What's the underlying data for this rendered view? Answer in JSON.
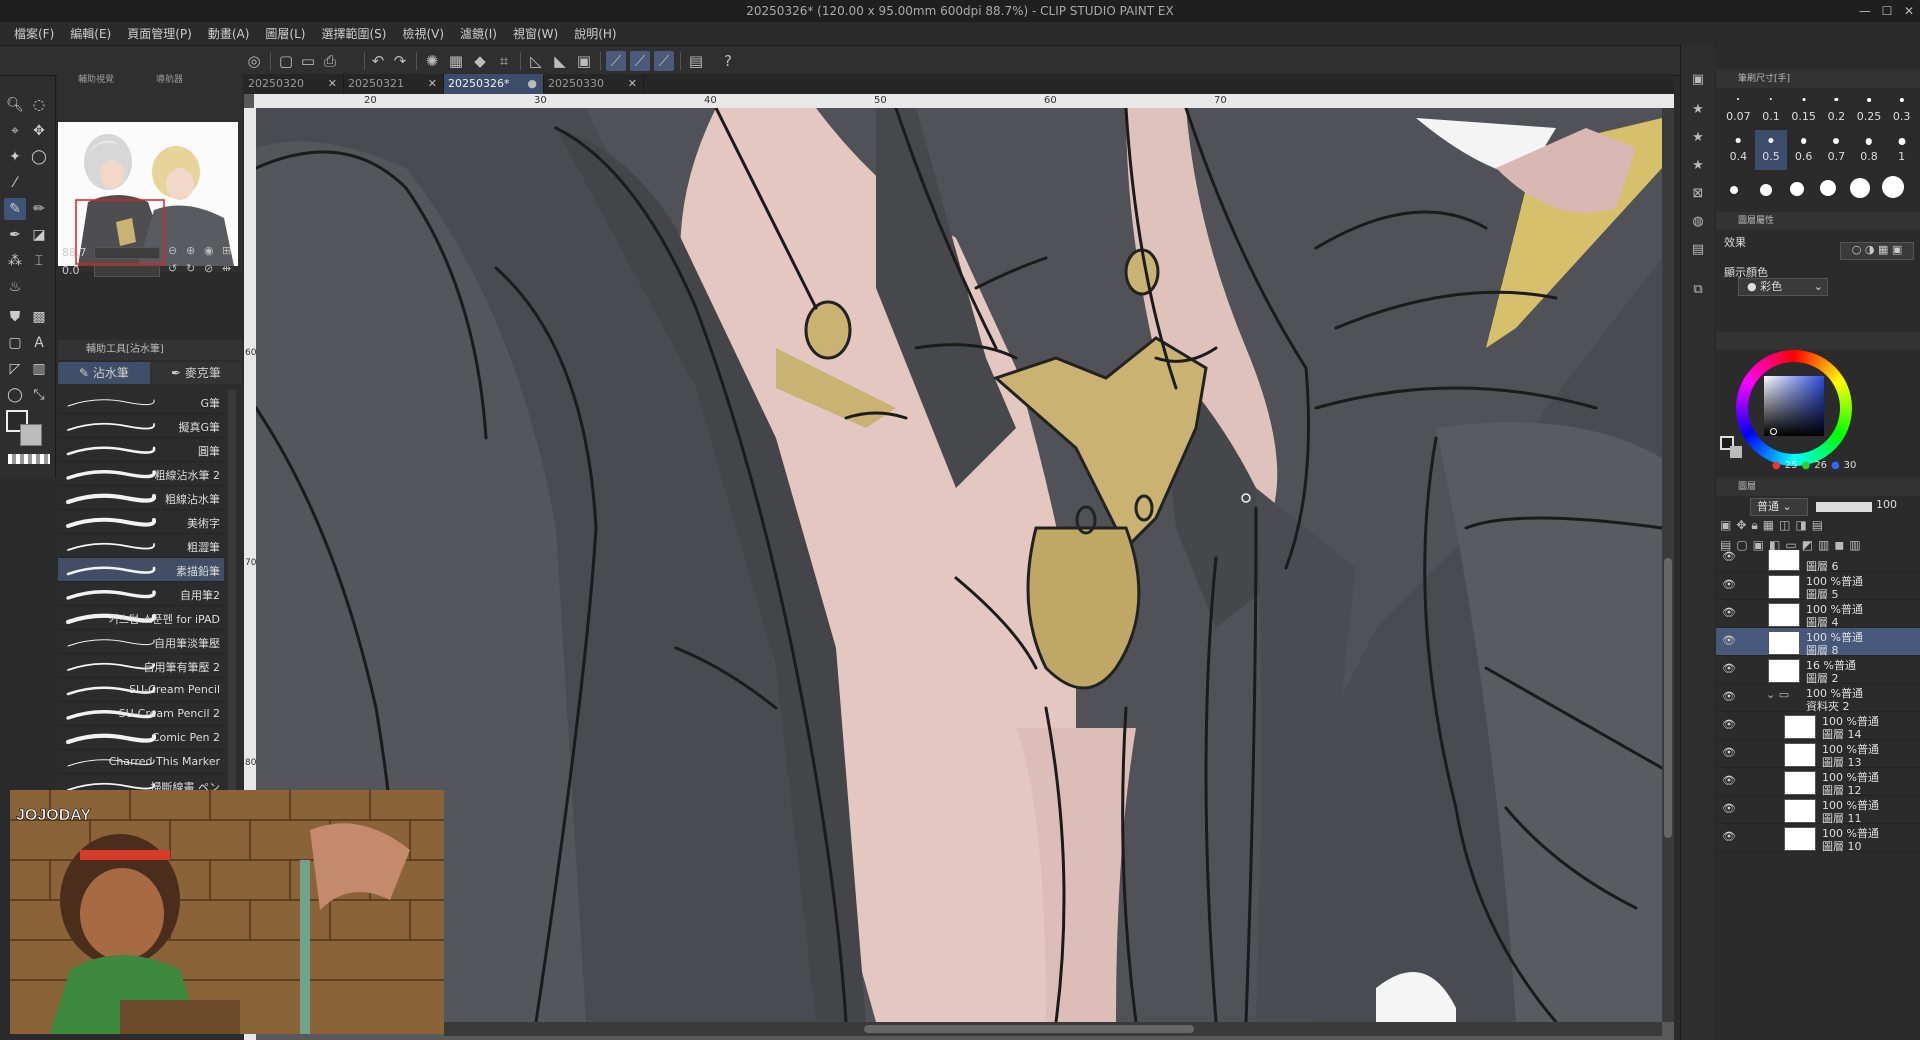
{
  "window": {
    "title": "20250326* (120.00 x 95.00mm 600dpi 88.7%)  - CLIP STUDIO PAINT EX"
  },
  "menu": [
    "檔案(F)",
    "編輯(E)",
    "頁面管理(P)",
    "動畫(A)",
    "圖層(L)",
    "選擇範圍(S)",
    "檢視(V)",
    "濾鏡(I)",
    "視窗(W)",
    "說明(H)"
  ],
  "nav_tabs": [
    "輔助視覺",
    "導航器"
  ],
  "zoom": {
    "scale": "88.7",
    "angle": "0.0"
  },
  "subtool": {
    "header": "輔助工具[沾水筆]",
    "tabs": [
      "沾水筆",
      "麥克筆"
    ],
    "brushes": [
      "G筆",
      "擬真G筆",
      "圓筆",
      "粗線沾水筆 2",
      "粗線沾水筆",
      "美術字",
      "粗澀筆",
      "素描鉛筆",
      "自用筆2",
      "커스텀 스푼펜 for iPAD",
      "自用筆淡筆壓",
      "自用筆有筆壓 2",
      "SU-Cream Pencil",
      "SU-Cream Pencil 2",
      "Comic Pen 2",
      "Charred This Marker",
      "掃斷線畫 ペン"
    ],
    "selected": "素描鉛筆"
  },
  "doc_tabs": [
    {
      "label": "20250320"
    },
    {
      "label": "20250321"
    },
    {
      "label": "20250326*",
      "active": true
    },
    {
      "label": "20250330"
    }
  ],
  "ruler_h": [
    "20",
    "30",
    "40",
    "50",
    "60",
    "70"
  ],
  "ruler_v": [
    "60",
    "70",
    "80"
  ],
  "brush_size": {
    "header": "筆刷尺寸[手]",
    "values": [
      "0.07",
      "0.1",
      "0.15",
      "0.2",
      "0.25",
      "0.3",
      "0.4",
      "0.5",
      "0.6",
      "0.7",
      "0.8",
      "1"
    ],
    "selected": "0.5"
  },
  "layer_props": {
    "header": "圖層屬性",
    "effect_label": "效果",
    "display_color_label": "顯示顏色",
    "display_color_value": "彩色"
  },
  "color": {
    "r": "25",
    "g": "26",
    "b": "30"
  },
  "layers_panel": {
    "header": "圖層",
    "blend": "普通",
    "opacity": "100"
  },
  "layers": [
    {
      "line1": "",
      "line2": "圖層 6"
    },
    {
      "line1": "100 %普通",
      "line2": "圖層 5"
    },
    {
      "line1": "100 %普通",
      "line2": "圖層 4"
    },
    {
      "line1": "100 %普通",
      "line2": "圖層 8",
      "sel": true
    },
    {
      "line1": "16 %普通",
      "line2": "圖層 2"
    },
    {
      "line1": "100 %普通",
      "line2": "資料夾 2",
      "folder": true
    },
    {
      "line1": "100 %普通",
      "line2": "圖層 14"
    },
    {
      "line1": "100 %普通",
      "line2": "圖層 13"
    },
    {
      "line1": "100 %普通",
      "line2": "圖層 12"
    },
    {
      "line1": "100 %普通",
      "line2": "圖層 11"
    },
    {
      "line1": "100 %普通",
      "line2": "圖層 10"
    }
  ],
  "video": {
    "logo": "JOJODAY"
  },
  "colors": {
    "accent": "#3c4d6b",
    "panel": "#2b2b2b",
    "skin": "#e7c9c4",
    "cloth": "#4c4d52",
    "gold": "#c9b272"
  }
}
